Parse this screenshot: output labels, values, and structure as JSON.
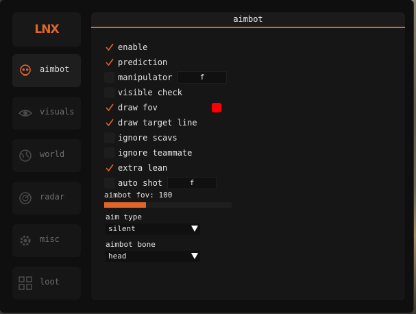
{
  "app": {
    "logo": "LNX",
    "accent": "#e0652a"
  },
  "sidebar": {
    "items": [
      {
        "label": "aimbot",
        "icon": "skull-icon",
        "active": true
      },
      {
        "label": "visuals",
        "icon": "eye-icon",
        "active": false
      },
      {
        "label": "world",
        "icon": "globe-icon",
        "active": false
      },
      {
        "label": "radar",
        "icon": "radar-icon",
        "active": false
      },
      {
        "label": "misc",
        "icon": "gear-icon",
        "active": false
      },
      {
        "label": "loot",
        "icon": "grid-icon",
        "active": false
      }
    ]
  },
  "panel": {
    "title": "aimbot",
    "options": [
      {
        "label": "enable",
        "checked": true
      },
      {
        "label": "prediction",
        "checked": true
      },
      {
        "label": "manipulator",
        "checked": false,
        "key": "f"
      },
      {
        "label": "visible check",
        "checked": false
      },
      {
        "label": "draw fov",
        "checked": true,
        "color": "#ff0000"
      },
      {
        "label": "draw target line",
        "checked": true
      },
      {
        "label": "ignore scavs",
        "checked": false
      },
      {
        "label": "ignore teammate",
        "checked": false
      },
      {
        "label": "extra lean",
        "checked": true
      },
      {
        "label": "auto shot",
        "checked": false,
        "key": "f"
      }
    ],
    "fov_slider": {
      "label": "aimbot fov: 100",
      "fraction": 0.33
    },
    "aim_type": {
      "label": "aim type",
      "value": "silent"
    },
    "aimbot_bone": {
      "label": "aimbot bone",
      "value": "head"
    }
  }
}
